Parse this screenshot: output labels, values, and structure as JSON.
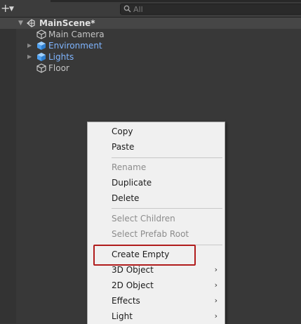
{
  "toolbar": {
    "add_icon": "plus-icon",
    "dropdown_icon": "caret-down-icon",
    "search": {
      "placeholder": "All",
      "icon": "search-icon"
    }
  },
  "hierarchy": {
    "scene": {
      "label": "MainScene*",
      "icon": "unity-scene-icon",
      "expanded": true
    },
    "items": [
      {
        "label": "Main Camera",
        "prefab": false,
        "has_children": false,
        "icon": "gameobject-cube-icon"
      },
      {
        "label": "Environment",
        "prefab": true,
        "has_children": true,
        "icon": "prefab-cube-icon"
      },
      {
        "label": "Lights",
        "prefab": true,
        "has_children": true,
        "icon": "prefab-cube-icon"
      },
      {
        "label": "Floor",
        "prefab": false,
        "has_children": false,
        "icon": "gameobject-cube-icon"
      }
    ],
    "colors": {
      "prefab_text": "#7fb5ff",
      "normal_text": "#c4c4c4"
    }
  },
  "context_menu": {
    "items": [
      {
        "label": "Copy",
        "enabled": true,
        "submenu": false
      },
      {
        "label": "Paste",
        "enabled": true,
        "submenu": false
      },
      {
        "label": "Rename",
        "enabled": false,
        "submenu": false
      },
      {
        "label": "Duplicate",
        "enabled": true,
        "submenu": false
      },
      {
        "label": "Delete",
        "enabled": true,
        "submenu": false
      },
      {
        "label": "Select Children",
        "enabled": false,
        "submenu": false
      },
      {
        "label": "Select Prefab Root",
        "enabled": false,
        "submenu": false
      },
      {
        "label": "Create Empty",
        "enabled": true,
        "submenu": false,
        "annotated": true
      },
      {
        "label": "3D Object",
        "enabled": true,
        "submenu": true
      },
      {
        "label": "2D Object",
        "enabled": true,
        "submenu": true
      },
      {
        "label": "Effects",
        "enabled": true,
        "submenu": true
      },
      {
        "label": "Light",
        "enabled": true,
        "submenu": true
      }
    ],
    "annotation_color": "#b01c1c"
  }
}
